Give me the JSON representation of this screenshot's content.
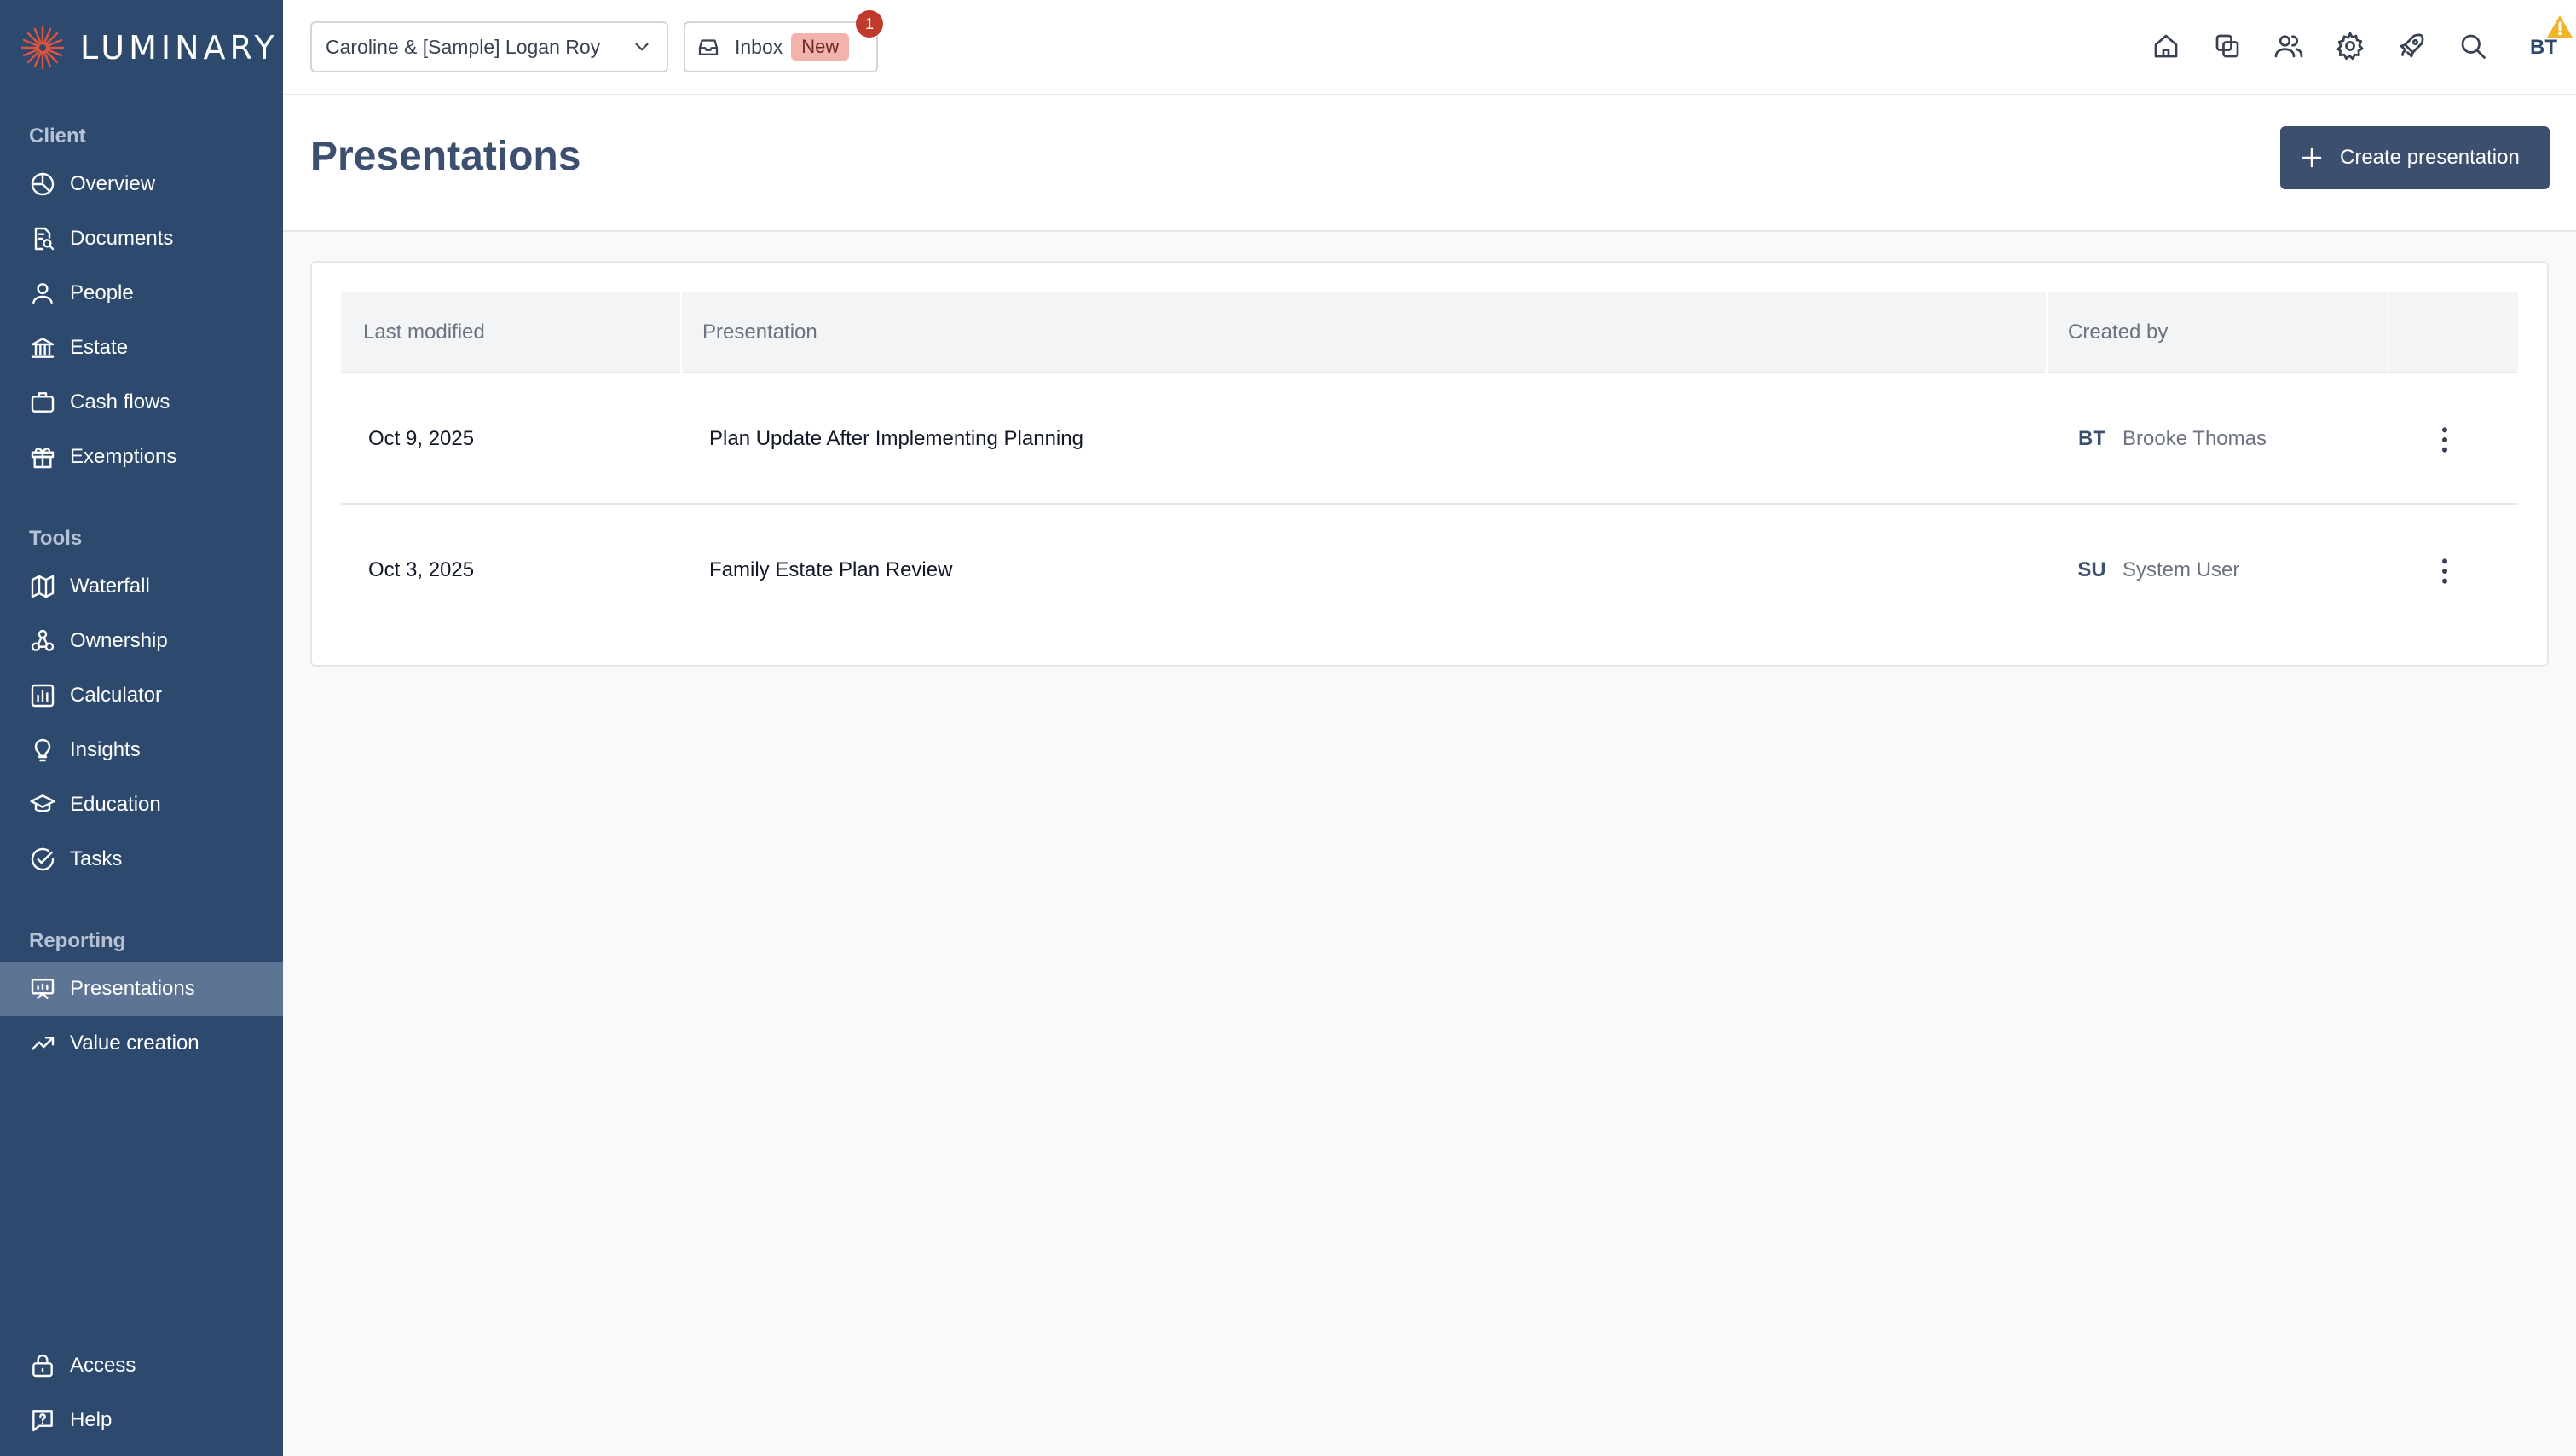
{
  "app": {
    "name": "LUMINARY",
    "accent": "#e0533e",
    "sidebar_bg": "#2d4a6e"
  },
  "sidebar": {
    "sections": [
      {
        "label": "Client",
        "items": [
          {
            "label": "Overview",
            "icon": "pie-chart-icon"
          },
          {
            "label": "Documents",
            "icon": "document-search-icon"
          },
          {
            "label": "People",
            "icon": "user-icon"
          },
          {
            "label": "Estate",
            "icon": "bank-icon"
          },
          {
            "label": "Cash flows",
            "icon": "briefcase-icon"
          },
          {
            "label": "Exemptions",
            "icon": "gift-icon"
          }
        ]
      },
      {
        "label": "Tools",
        "items": [
          {
            "label": "Waterfall",
            "icon": "map-icon"
          },
          {
            "label": "Ownership",
            "icon": "ownership-icon"
          },
          {
            "label": "Calculator",
            "icon": "bar-chart-icon"
          },
          {
            "label": "Insights",
            "icon": "lightbulb-icon"
          },
          {
            "label": "Education",
            "icon": "graduation-cap-icon"
          },
          {
            "label": "Tasks",
            "icon": "check-circle-icon"
          }
        ]
      },
      {
        "label": "Reporting",
        "items": [
          {
            "label": "Presentations",
            "icon": "presentation-icon",
            "active": true
          },
          {
            "label": "Value creation",
            "icon": "trend-up-icon"
          }
        ]
      }
    ],
    "footer": [
      {
        "label": "Access",
        "icon": "lock-icon"
      },
      {
        "label": "Help",
        "icon": "help-icon"
      }
    ]
  },
  "header": {
    "client_select": "Caroline & [Sample] Logan Roy",
    "inbox": {
      "label": "Inbox",
      "badge": "New",
      "count": "1"
    },
    "icons": [
      "home-icon",
      "copy-icon",
      "users-icon",
      "gear-icon",
      "rocket-icon",
      "search-icon"
    ],
    "user_initials": "BT"
  },
  "page": {
    "title": "Presentations",
    "create_button": "Create presentation"
  },
  "table": {
    "columns": [
      "Last modified",
      "Presentation",
      "Created by"
    ],
    "rows": [
      {
        "last_modified": "Oct 9, 2025",
        "presentation": "Plan Update After Implementing Planning",
        "initials": "BT",
        "created_by": "Brooke Thomas"
      },
      {
        "last_modified": "Oct 3, 2025",
        "presentation": "Family Estate Plan Review",
        "initials": "SU",
        "created_by": "System User"
      }
    ]
  }
}
